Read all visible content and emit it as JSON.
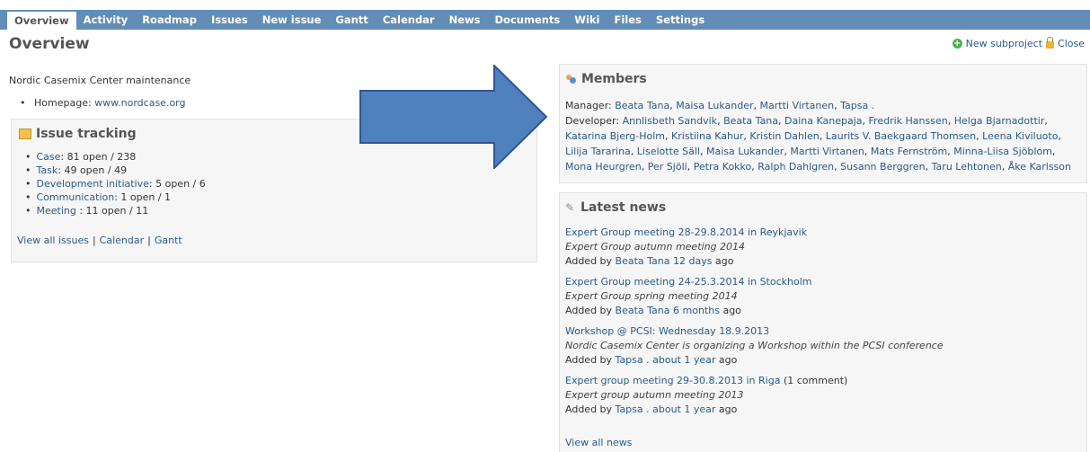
{
  "tabs": [
    {
      "label": "Overview",
      "selected": true
    },
    {
      "label": "Activity"
    },
    {
      "label": "Roadmap"
    },
    {
      "label": "Issues"
    },
    {
      "label": "New issue"
    },
    {
      "label": "Gantt"
    },
    {
      "label": "Calendar"
    },
    {
      "label": "News"
    },
    {
      "label": "Documents"
    },
    {
      "label": "Wiki"
    },
    {
      "label": "Files"
    },
    {
      "label": "Settings"
    }
  ],
  "page": {
    "title": "Overview",
    "new_subproject": "New subproject",
    "close": "Close",
    "description": "Nordic Casemix Center maintenance",
    "homepage_label": "Homepage:",
    "homepage_url": "www.nordcase.org"
  },
  "issue_tracking": {
    "title": "Issue tracking",
    "trackers": [
      {
        "name": "Case",
        "counts": ": 81 open / 238"
      },
      {
        "name": "Task",
        "counts": ": 49 open / 49"
      },
      {
        "name": "Development initiative",
        "counts": ": 5 open / 6"
      },
      {
        "name": "Communication",
        "counts": ": 1 open / 1"
      },
      {
        "name": "Meeting ",
        "counts": ": 11 open / 11"
      }
    ],
    "links": {
      "view_all": "View all issues",
      "calendar": "Calendar",
      "gantt": "Gantt",
      "separator": "|"
    }
  },
  "members": {
    "title": "Members",
    "manager_label": "Manager:",
    "managers": [
      "Beata Tana",
      "Maisa Lukander",
      "Martti Virtanen",
      "Tapsa ."
    ],
    "developer_label": "Developer:",
    "developers": [
      "Annlisbeth Sandvik",
      "Beata Tana",
      "Daina Kanepaja",
      "Fredrik Hanssen",
      "Helga Bjarnadottir",
      "Katarina Bjerg-Holm",
      "Kristiina Kahur",
      "Kristin Dahlen",
      "Laurits V. Baekgaard Thomsen",
      "Leena Kiviluoto",
      "Lilija Tararina",
      "Liselotte Säll",
      "Maisa Lukander",
      "Martti Virtanen",
      "Mats Fernström",
      "Minna-Liisa Sjöblom",
      "Mona Heurgren",
      "Per Sjöli",
      "Petra Kokko",
      "Ralph Dahlgren",
      "Susann Berggren",
      "Taru Lehtonen",
      "Åke Karlsson"
    ]
  },
  "news": {
    "title": "Latest news",
    "added_by": "Added by",
    "items": [
      {
        "title": "Expert Group meeting 28-29.8.2014 in Reykjavik",
        "extra": "",
        "summary": "Expert Group autumn meeting 2014",
        "author": "Beata Tana",
        "age": "12 days",
        "ago": "ago"
      },
      {
        "title": "Expert Group meeting 24-25.3.2014 in Stockholm",
        "extra": "",
        "summary": "Expert Group spring meeting 2014",
        "author": "Beata Tana",
        "age": "6 months",
        "ago": "ago"
      },
      {
        "title": "Workshop @ PCSI: Wednesday 18.9.2013",
        "extra": "",
        "summary": "Nordic Casemix Center is organizing a Workshop within the PCSI conference",
        "author": "Tapsa .",
        "age": "about 1 year",
        "ago": "ago"
      },
      {
        "title": "Expert group meeting 29-30.8.2013 in Riga",
        "extra": "(1 comment)",
        "summary": "Expert group autumn meeting 2013",
        "author": "Tapsa .",
        "age": "about 1 year",
        "ago": "ago"
      }
    ],
    "view_all": "View all news"
  },
  "colors": {
    "tabbar": "#628db6",
    "link": "#2a5a8a",
    "arrow_fill": "#4f81bd",
    "arrow_stroke": "#2f5597"
  }
}
